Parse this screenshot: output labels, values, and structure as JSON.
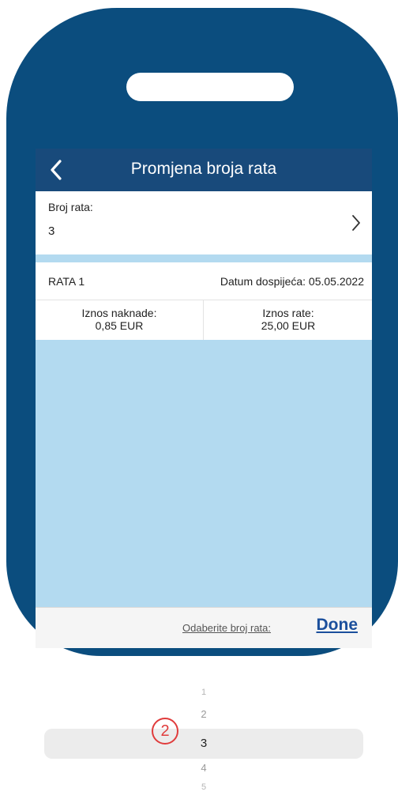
{
  "header": {
    "title": "Promjena broja rata"
  },
  "installments_field": {
    "label": "Broj rata:",
    "value": "3"
  },
  "rate": {
    "title": "RATA 1",
    "due_date": "Datum dospijeća: 05.05.2022",
    "fee_label": "Iznos naknade:",
    "fee_value": "0,85 EUR",
    "rate_label": "Iznos rate:",
    "rate_value": "25,00 EUR"
  },
  "picker": {
    "prompt": "Odaberite broj rata:",
    "done_label": "Done",
    "options": [
      "1",
      "2",
      "3",
      "4",
      "5"
    ],
    "selected": "3"
  },
  "annotation": {
    "step_number": "2"
  },
  "colors": {
    "frame": "#0b4d7e",
    "navbar": "#184a7b",
    "screen_bg": "#b3daf0",
    "done": "#1b4f9c",
    "annotation": "#e03c3c"
  },
  "icons": {
    "back": "chevron-left-icon",
    "forward": "chevron-right-icon"
  }
}
